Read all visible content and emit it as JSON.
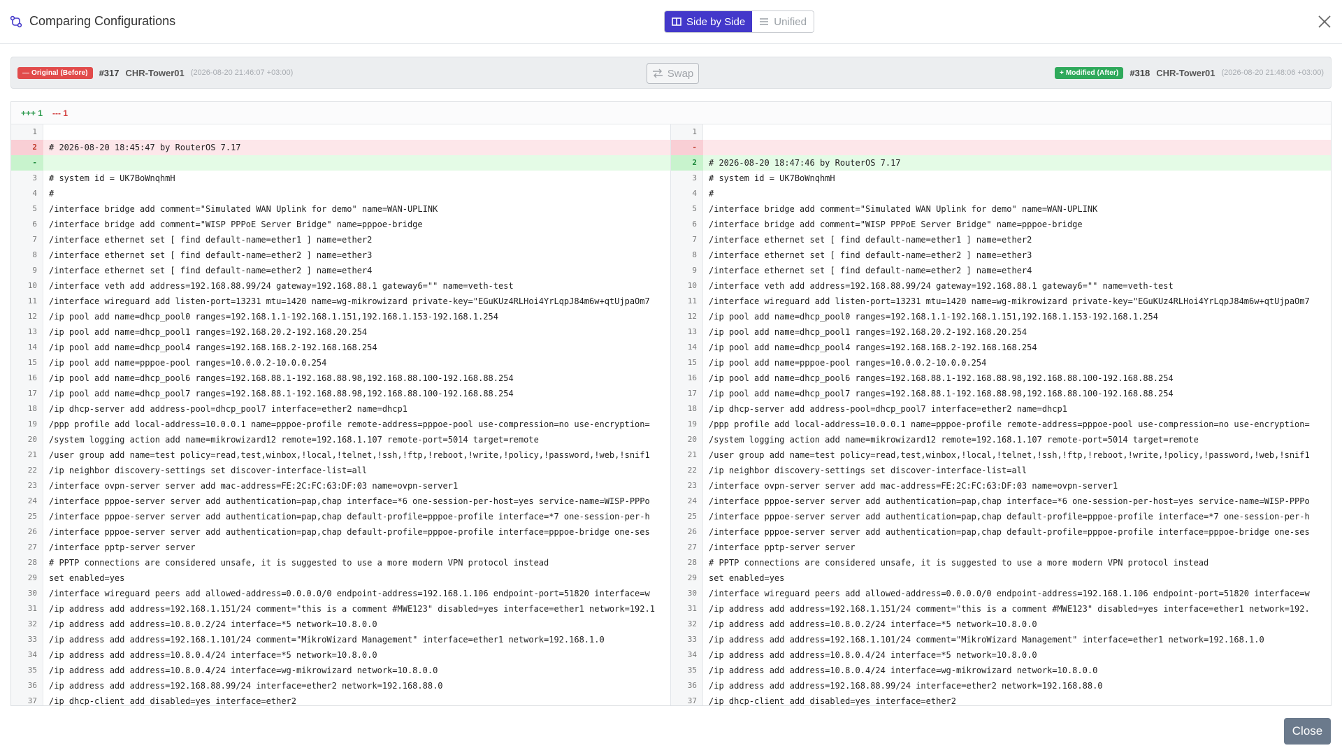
{
  "header": {
    "title": "Comparing Configurations",
    "toggle": {
      "side_by_side": "Side by Side",
      "unified": "Unified"
    }
  },
  "compare": {
    "left": {
      "badge": "— Original (Before)",
      "id": "#317",
      "device": "CHR-Tower01",
      "timestamp": "(2026-08-20 21:46:07 +03:00)"
    },
    "right": {
      "badge": "+ Modified (After)",
      "id": "#318",
      "device": "CHR-Tower01",
      "timestamp": "(2026-08-20 21:48:06 +03:00)"
    },
    "swap_label": "Swap"
  },
  "stats": {
    "added": "+++ 1",
    "removed": "--- 1"
  },
  "colors": {
    "accent": "#4338ca",
    "deleted": "#e14b4b",
    "added": "#2fa95b"
  },
  "diff": {
    "left": [
      {
        "n": "1",
        "t": "",
        "k": "ctx"
      },
      {
        "n": "2",
        "t": "# 2026-08-20 18:45:47 by RouterOS 7.17",
        "k": "del"
      },
      {
        "n": "-",
        "t": "",
        "k": "empty-add"
      },
      {
        "n": "3",
        "t": "# system id = UK7BoWnqhmH",
        "k": "ctx"
      },
      {
        "n": "4",
        "t": "#",
        "k": "ctx"
      },
      {
        "n": "5",
        "t": "/interface bridge add comment=\"Simulated WAN Uplink for demo\" name=WAN-UPLINK",
        "k": "ctx"
      },
      {
        "n": "6",
        "t": "/interface bridge add comment=\"WISP PPPoE Server Bridge\" name=pppoe-bridge",
        "k": "ctx"
      },
      {
        "n": "7",
        "t": "/interface ethernet set [ find default-name=ether1 ] name=ether2",
        "k": "ctx"
      },
      {
        "n": "8",
        "t": "/interface ethernet set [ find default-name=ether2 ] name=ether3",
        "k": "ctx"
      },
      {
        "n": "9",
        "t": "/interface ethernet set [ find default-name=ether2 ] name=ether4",
        "k": "ctx"
      },
      {
        "n": "10",
        "t": "/interface veth add address=192.168.88.99/24 gateway=192.168.88.1 gateway6=\"\" name=veth-test",
        "k": "ctx"
      },
      {
        "n": "11",
        "t": "/interface wireguard add listen-port=13231 mtu=1420 name=wg-mikrowizard private-key=\"EGuKUz4RLHoi4YrLqpJ84m6w+qtUjpaOm7",
        "k": "ctx"
      },
      {
        "n": "12",
        "t": "/ip pool add name=dhcp_pool0 ranges=192.168.1.1-192.168.1.151,192.168.1.153-192.168.1.254",
        "k": "ctx"
      },
      {
        "n": "13",
        "t": "/ip pool add name=dhcp_pool1 ranges=192.168.20.2-192.168.20.254",
        "k": "ctx"
      },
      {
        "n": "14",
        "t": "/ip pool add name=dhcp_pool4 ranges=192.168.168.2-192.168.168.254",
        "k": "ctx"
      },
      {
        "n": "15",
        "t": "/ip pool add name=pppoe-pool ranges=10.0.0.2-10.0.0.254",
        "k": "ctx"
      },
      {
        "n": "16",
        "t": "/ip pool add name=dhcp_pool6 ranges=192.168.88.1-192.168.88.98,192.168.88.100-192.168.88.254",
        "k": "ctx"
      },
      {
        "n": "17",
        "t": "/ip pool add name=dhcp_pool7 ranges=192.168.88.1-192.168.88.98,192.168.88.100-192.168.88.254",
        "k": "ctx"
      },
      {
        "n": "18",
        "t": "/ip dhcp-server add address-pool=dhcp_pool7 interface=ether2 name=dhcp1",
        "k": "ctx"
      },
      {
        "n": "19",
        "t": "/ppp profile add local-address=10.0.0.1 name=pppoe-profile remote-address=pppoe-pool use-compression=no use-encryption=",
        "k": "ctx"
      },
      {
        "n": "20",
        "t": "/system logging action add name=mikrowizard12 remote=192.168.1.107 remote-port=5014 target=remote",
        "k": "ctx"
      },
      {
        "n": "21",
        "t": "/user group add name=test policy=read,test,winbox,!local,!telnet,!ssh,!ftp,!reboot,!write,!policy,!password,!web,!snif1",
        "k": "ctx"
      },
      {
        "n": "22",
        "t": "/ip neighbor discovery-settings set discover-interface-list=all",
        "k": "ctx"
      },
      {
        "n": "23",
        "t": "/interface ovpn-server server add mac-address=FE:2C:FC:63:DF:03 name=ovpn-server1",
        "k": "ctx"
      },
      {
        "n": "24",
        "t": "/interface pppoe-server server add authentication=pap,chap interface=*6 one-session-per-host=yes service-name=WISP-PPPo",
        "k": "ctx"
      },
      {
        "n": "25",
        "t": "/interface pppoe-server server add authentication=pap,chap default-profile=pppoe-profile interface=*7 one-session-per-h",
        "k": "ctx"
      },
      {
        "n": "26",
        "t": "/interface pppoe-server server add authentication=pap,chap default-profile=pppoe-profile interface=pppoe-bridge one-ses",
        "k": "ctx"
      },
      {
        "n": "27",
        "t": "/interface pptp-server server",
        "k": "ctx"
      },
      {
        "n": "28",
        "t": "# PPTP connections are considered unsafe, it is suggested to use a more modern VPN protocol instead",
        "k": "ctx"
      },
      {
        "n": "29",
        "t": "set enabled=yes",
        "k": "ctx"
      },
      {
        "n": "30",
        "t": "/interface wireguard peers add allowed-address=0.0.0.0/0 endpoint-address=192.168.1.106 endpoint-port=51820 interface=w",
        "k": "ctx"
      },
      {
        "n": "31",
        "t": "/ip address add address=192.168.1.151/24 comment=\"this is a comment #MWE123\" disabled=yes interface=ether1 network=192.1",
        "k": "ctx"
      },
      {
        "n": "32",
        "t": "/ip address add address=10.8.0.2/24 interface=*5 network=10.8.0.0",
        "k": "ctx"
      },
      {
        "n": "33",
        "t": "/ip address add address=192.168.1.101/24 comment=\"MikroWizard Management\" interface=ether1 network=192.168.1.0",
        "k": "ctx"
      },
      {
        "n": "34",
        "t": "/ip address add address=10.8.0.4/24 interface=*5 network=10.8.0.0",
        "k": "ctx"
      },
      {
        "n": "35",
        "t": "/ip address add address=10.8.0.4/24 interface=wg-mikrowizard network=10.8.0.0",
        "k": "ctx"
      },
      {
        "n": "36",
        "t": "/ip address add address=192.168.88.99/24 interface=ether2 network=192.168.88.0",
        "k": "ctx"
      },
      {
        "n": "37",
        "t": "/ip dhcp-client add disabled=yes interface=ether2",
        "k": "ctx"
      }
    ],
    "right": [
      {
        "n": "1",
        "t": "",
        "k": "ctx"
      },
      {
        "n": "-",
        "t": "",
        "k": "empty-del"
      },
      {
        "n": "2",
        "t": "# 2026-08-20 18:47:46 by RouterOS 7.17",
        "k": "add"
      },
      {
        "n": "3",
        "t": "# system id = UK7BoWnqhmH",
        "k": "ctx"
      },
      {
        "n": "4",
        "t": "#",
        "k": "ctx"
      },
      {
        "n": "5",
        "t": "/interface bridge add comment=\"Simulated WAN Uplink for demo\" name=WAN-UPLINK",
        "k": "ctx"
      },
      {
        "n": "6",
        "t": "/interface bridge add comment=\"WISP PPPoE Server Bridge\" name=pppoe-bridge",
        "k": "ctx"
      },
      {
        "n": "7",
        "t": "/interface ethernet set [ find default-name=ether1 ] name=ether2",
        "k": "ctx"
      },
      {
        "n": "8",
        "t": "/interface ethernet set [ find default-name=ether2 ] name=ether3",
        "k": "ctx"
      },
      {
        "n": "9",
        "t": "/interface ethernet set [ find default-name=ether2 ] name=ether4",
        "k": "ctx"
      },
      {
        "n": "10",
        "t": "/interface veth add address=192.168.88.99/24 gateway=192.168.88.1 gateway6=\"\" name=veth-test",
        "k": "ctx"
      },
      {
        "n": "11",
        "t": "/interface wireguard add listen-port=13231 mtu=1420 name=wg-mikrowizard private-key=\"EGuKUz4RLHoi4YrLqpJ84m6w+qtUjpaOm7",
        "k": "ctx"
      },
      {
        "n": "12",
        "t": "/ip pool add name=dhcp_pool0 ranges=192.168.1.1-192.168.1.151,192.168.1.153-192.168.1.254",
        "k": "ctx"
      },
      {
        "n": "13",
        "t": "/ip pool add name=dhcp_pool1 ranges=192.168.20.2-192.168.20.254",
        "k": "ctx"
      },
      {
        "n": "14",
        "t": "/ip pool add name=dhcp_pool4 ranges=192.168.168.2-192.168.168.254",
        "k": "ctx"
      },
      {
        "n": "15",
        "t": "/ip pool add name=pppoe-pool ranges=10.0.0.2-10.0.0.254",
        "k": "ctx"
      },
      {
        "n": "16",
        "t": "/ip pool add name=dhcp_pool6 ranges=192.168.88.1-192.168.88.98,192.168.88.100-192.168.88.254",
        "k": "ctx"
      },
      {
        "n": "17",
        "t": "/ip pool add name=dhcp_pool7 ranges=192.168.88.1-192.168.88.98,192.168.88.100-192.168.88.254",
        "k": "ctx"
      },
      {
        "n": "18",
        "t": "/ip dhcp-server add address-pool=dhcp_pool7 interface=ether2 name=dhcp1",
        "k": "ctx"
      },
      {
        "n": "19",
        "t": "/ppp profile add local-address=10.0.0.1 name=pppoe-profile remote-address=pppoe-pool use-compression=no use-encryption=",
        "k": "ctx"
      },
      {
        "n": "20",
        "t": "/system logging action add name=mikrowizard12 remote=192.168.1.107 remote-port=5014 target=remote",
        "k": "ctx"
      },
      {
        "n": "21",
        "t": "/user group add name=test policy=read,test,winbox,!local,!telnet,!ssh,!ftp,!reboot,!write,!policy,!password,!web,!snif1",
        "k": "ctx"
      },
      {
        "n": "22",
        "t": "/ip neighbor discovery-settings set discover-interface-list=all",
        "k": "ctx"
      },
      {
        "n": "23",
        "t": "/interface ovpn-server server add mac-address=FE:2C:FC:63:DF:03 name=ovpn-server1",
        "k": "ctx"
      },
      {
        "n": "24",
        "t": "/interface pppoe-server server add authentication=pap,chap interface=*6 one-session-per-host=yes service-name=WISP-PPPo",
        "k": "ctx"
      },
      {
        "n": "25",
        "t": "/interface pppoe-server server add authentication=pap,chap default-profile=pppoe-profile interface=*7 one-session-per-h",
        "k": "ctx"
      },
      {
        "n": "26",
        "t": "/interface pppoe-server server add authentication=pap,chap default-profile=pppoe-profile interface=pppoe-bridge one-ses",
        "k": "ctx"
      },
      {
        "n": "27",
        "t": "/interface pptp-server server",
        "k": "ctx"
      },
      {
        "n": "28",
        "t": "# PPTP connections are considered unsafe, it is suggested to use a more modern VPN protocol instead",
        "k": "ctx"
      },
      {
        "n": "29",
        "t": "set enabled=yes",
        "k": "ctx"
      },
      {
        "n": "30",
        "t": "/interface wireguard peers add allowed-address=0.0.0.0/0 endpoint-address=192.168.1.106 endpoint-port=51820 interface=w",
        "k": "ctx"
      },
      {
        "n": "31",
        "t": "/ip address add address=192.168.1.151/24 comment=\"this is a comment #MWE123\" disabled=yes interface=ether1 network=192.",
        "k": "ctx"
      },
      {
        "n": "32",
        "t": "/ip address add address=10.8.0.2/24 interface=*5 network=10.8.0.0",
        "k": "ctx"
      },
      {
        "n": "33",
        "t": "/ip address add address=192.168.1.101/24 comment=\"MikroWizard Management\" interface=ether1 network=192.168.1.0",
        "k": "ctx"
      },
      {
        "n": "34",
        "t": "/ip address add address=10.8.0.4/24 interface=*5 network=10.8.0.0",
        "k": "ctx"
      },
      {
        "n": "35",
        "t": "/ip address add address=10.8.0.4/24 interface=wg-mikrowizard network=10.8.0.0",
        "k": "ctx"
      },
      {
        "n": "36",
        "t": "/ip address add address=192.168.88.99/24 interface=ether2 network=192.168.88.0",
        "k": "ctx"
      },
      {
        "n": "37",
        "t": "/ip dhcp-client add disabled=yes interface=ether2",
        "k": "ctx"
      }
    ]
  },
  "footer": {
    "close_label": "Close"
  }
}
